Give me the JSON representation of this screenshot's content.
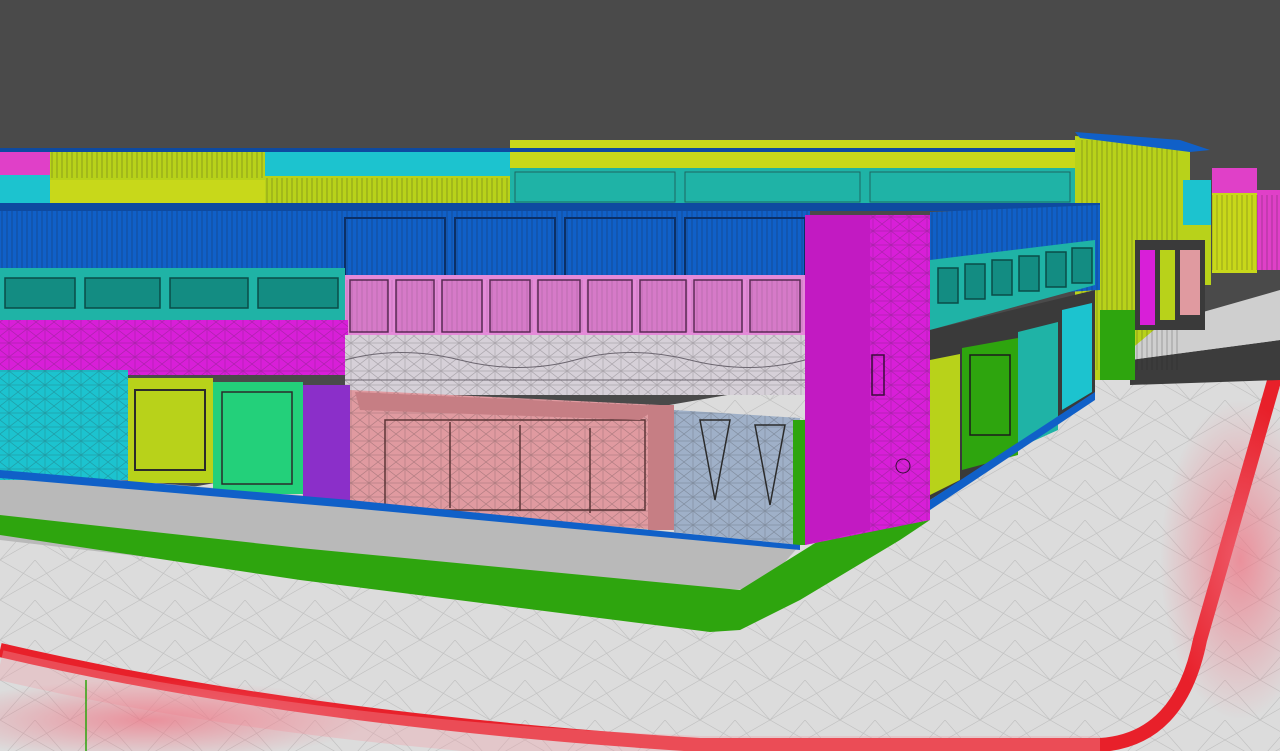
{
  "viewport": {
    "description_label": "",
    "background": "#4a4a4a",
    "shading_mode": "wireframe-over-material-id",
    "wire_color": "#2b2b2b"
  },
  "materials": {
    "magenta": "#d81fd8",
    "hot_pink": "#e040c8",
    "cyan": "#1cc3cf",
    "teal": "#1fb3a6",
    "lime": "#b8d21a",
    "yellow_green": "#c8d81a",
    "blue": "#1060c8",
    "dark_blue": "#0e4aa0",
    "pink_light": "#e48ad8",
    "salmon": "#e09aa0",
    "light_gray": "#d6d0d8",
    "steel_blue": "#9fb0c8",
    "green": "#2ea50e",
    "violet": "#8b2fc9",
    "sea_green": "#23d07a",
    "ground": "#dcdcdc",
    "road": "#b9b9b9",
    "curb_red": "#e8202a"
  },
  "objects": [
    {
      "name": "upper-facade-left",
      "material": "cyan"
    },
    {
      "name": "upper-facade-middle",
      "material": "yellow_green"
    },
    {
      "name": "roof-band",
      "material": "blue"
    },
    {
      "name": "window-band-left",
      "material": "teal"
    },
    {
      "name": "window-band-right",
      "material": "pink_light"
    },
    {
      "name": "ornament-band",
      "material": "light_gray"
    },
    {
      "name": "storefront-left",
      "material": "cyan"
    },
    {
      "name": "storefront-door",
      "material": "salmon"
    },
    {
      "name": "storefront-panel",
      "material": "steel_blue"
    },
    {
      "name": "corner-pillar",
      "material": "magenta"
    },
    {
      "name": "side-facade",
      "material": "teal"
    },
    {
      "name": "distant-building",
      "material": "yellow_green"
    },
    {
      "name": "sidewalk-curb",
      "material": "green"
    },
    {
      "name": "street-curb",
      "material": "curb_red"
    }
  ]
}
